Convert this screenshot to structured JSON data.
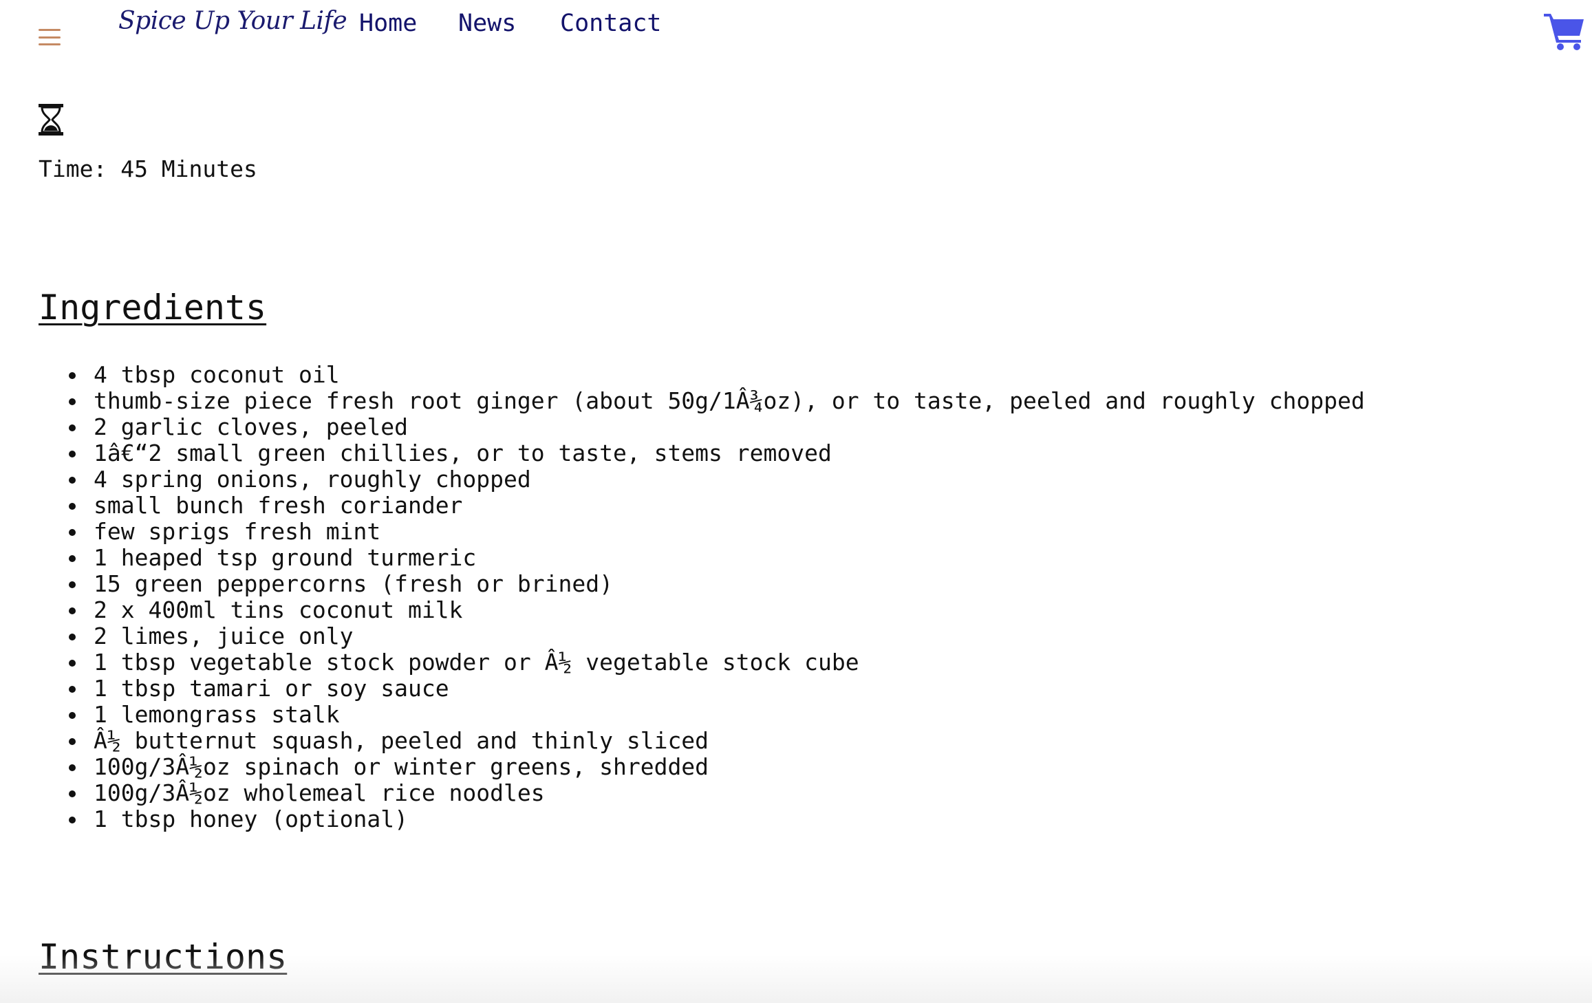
{
  "header": {
    "brand": "Spice Up Your Life",
    "nav": {
      "home": "Home",
      "news": "News",
      "contact": "Contact"
    },
    "menu_icon": "hamburger-menu-icon",
    "cart_icon": "shopping-cart-icon"
  },
  "recipe": {
    "time_icon": "hourglass-icon",
    "time_label": "Time: 45 Minutes",
    "ingredients_heading": "Ingredients",
    "ingredients": [
      "4 tbsp coconut oil",
      "thumb-size piece fresh root ginger (about 50g/1Â¾oz), or to taste, peeled and roughly chopped",
      "2 garlic cloves, peeled",
      "1â€“2 small green chillies, or to taste, stems removed",
      "4 spring onions, roughly chopped",
      "small bunch fresh coriander",
      "few sprigs fresh mint",
      "1 heaped tsp ground turmeric",
      "15 green peppercorns (fresh or brined)",
      "2 x 400ml tins coconut milk",
      "2 limes, juice only",
      "1 tbsp vegetable stock powder or Â½ vegetable stock cube",
      "1 tbsp tamari or soy sauce",
      "1 lemongrass stalk",
      "Â½ butternut squash, peeled and thinly sliced",
      "100g/3Â½oz spinach or winter greens, shredded",
      "100g/3Â½oz wholemeal rice noodles",
      "1 tbsp honey (optional)"
    ],
    "instructions_heading": "Instructions"
  },
  "colors": {
    "menu_icon": "#c58a63",
    "nav_text": "#13136b",
    "cart_icon": "#4a55e8",
    "body_text": "#111111"
  }
}
